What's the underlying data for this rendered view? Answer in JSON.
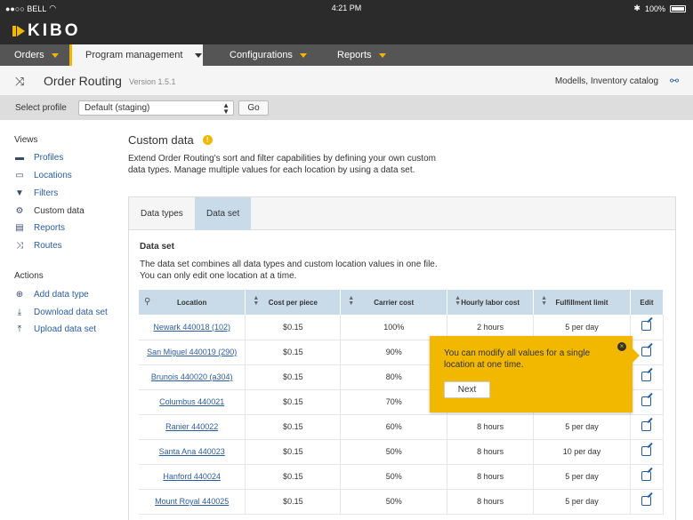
{
  "status_bar": {
    "carrier": "●●○○ BELL",
    "time": "4:21 PM",
    "battery": "100%"
  },
  "brand": {
    "logo": "KIBO"
  },
  "nav": [
    {
      "label": "Orders"
    },
    {
      "label": "Program management"
    },
    {
      "label": "Configurations"
    },
    {
      "label": "Reports"
    }
  ],
  "header": {
    "title": "Order Routing",
    "version": "Version 1.5.1",
    "catalog": "Modells,  Inventory catalog"
  },
  "profile": {
    "label": "Select profile",
    "selected": "Default (staging)",
    "go": "Go"
  },
  "sidebar": {
    "views_heading": "Views",
    "views": [
      {
        "label": "Profiles",
        "icon": "folder-icon"
      },
      {
        "label": "Locations",
        "icon": "store-icon"
      },
      {
        "label": "Filters",
        "icon": "filter-icon"
      },
      {
        "label": "Custom data",
        "icon": "gears-icon"
      },
      {
        "label": "Reports",
        "icon": "report-icon"
      },
      {
        "label": "Routes",
        "icon": "shuffle-icon"
      }
    ],
    "actions_heading": "Actions",
    "actions": [
      {
        "label": "Add data type",
        "icon": "plus-circle-icon"
      },
      {
        "label": "Download data set",
        "icon": "download-icon"
      },
      {
        "label": "Upload data set",
        "icon": "upload-icon"
      }
    ]
  },
  "main": {
    "title": "Custom data",
    "description": "Extend Order Routing's sort and filter capabilities by defining your own custom data types. Manage multiple values for each location by using a data set.",
    "tabs": [
      {
        "label": "Data types"
      },
      {
        "label": "Data set"
      }
    ],
    "dataset_title": "Data set",
    "dataset_desc_1": "The data set combines all data types and custom location values in one file.",
    "dataset_desc_2": "You can only edit one location at a time.",
    "columns": [
      "Location",
      "Cost per piece",
      "Carrier cost",
      "Hourly labor cost",
      "Fulfillment limit",
      "Edit"
    ],
    "rows": [
      {
        "location": "Newark 440018 (102)",
        "cost": "$0.15",
        "carrier": "100%",
        "labor": "2 hours",
        "limit": "5 per day"
      },
      {
        "location": "San Miguel 440019 (290)",
        "cost": "$0.15",
        "carrier": "90%",
        "labor": "",
        "limit": ""
      },
      {
        "location": "Brunois 440020 (a304)",
        "cost": "$0.15",
        "carrier": "80%",
        "labor": "",
        "limit": ""
      },
      {
        "location": "Columbus 440021",
        "cost": "$0.15",
        "carrier": "70%",
        "labor": "",
        "limit": ""
      },
      {
        "location": "Ranier 440022",
        "cost": "$0.15",
        "carrier": "60%",
        "labor": "8 hours",
        "limit": "5 per day"
      },
      {
        "location": "Santa Ana 440023",
        "cost": "$0.15",
        "carrier": "50%",
        "labor": "8 hours",
        "limit": "10 per day"
      },
      {
        "location": "Hanford 440024",
        "cost": "$0.15",
        "carrier": "50%",
        "labor": "8 hours",
        "limit": "5 per day"
      },
      {
        "location": "Mount Royal 440025",
        "cost": "$0.15",
        "carrier": "50%",
        "labor": "8 hours",
        "limit": "5 per day"
      }
    ]
  },
  "tooltip": {
    "message": "You can modify all values for a single location at one time.",
    "next": "Next"
  },
  "colors": {
    "accent": "#f2b800",
    "link": "#2a5d9f",
    "header_bg": "#2b2b2b",
    "nav_bg": "#555555",
    "table_header": "#c9dbe9"
  }
}
